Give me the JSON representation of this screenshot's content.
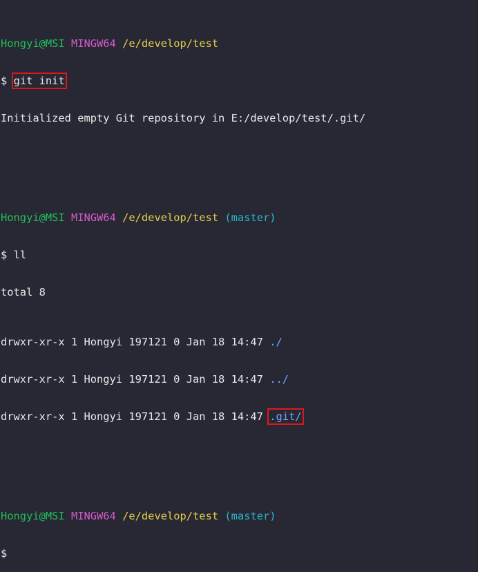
{
  "prompts": [
    {
      "user": "Hongyi@MSI",
      "system": "MINGW64",
      "path": "/e/develop/test",
      "branch": ""
    },
    {
      "user": "Hongyi@MSI",
      "system": "MINGW64",
      "path": "/e/develop/test",
      "branch": "(master)"
    },
    {
      "user": "Hongyi@MSI",
      "system": "MINGW64",
      "path": "/e/develop/test",
      "branch": "(master)"
    }
  ],
  "commands": {
    "init": {
      "prompt_symbol": "$",
      "text": "git init"
    },
    "list": {
      "prompt_symbol": "$",
      "text": "ll"
    },
    "final": {
      "prompt_symbol": "$"
    }
  },
  "output": {
    "init_message": "Initialized empty Git repository in E:/develop/test/.git/",
    "total": "total 8",
    "entries": [
      {
        "meta": "drwxr-xr-x 1 Hongyi 197121 0 Jan 18 14:47",
        "name": "./"
      },
      {
        "meta": "drwxr-xr-x 1 Hongyi 197121 0 Jan 18 14:47",
        "name": "../"
      },
      {
        "meta": "drwxr-xr-x 1 Hongyi 197121 0 Jan 18 14:47",
        "name": ".git/"
      }
    ]
  },
  "colors": {
    "background": "#272833",
    "text": "#e8e8e8",
    "user": "#20c05a",
    "system": "#d65ac9",
    "path": "#e6cf4a",
    "branch": "#28b7cf",
    "directory": "#6aa7ff",
    "highlight": "#e0161d"
  }
}
